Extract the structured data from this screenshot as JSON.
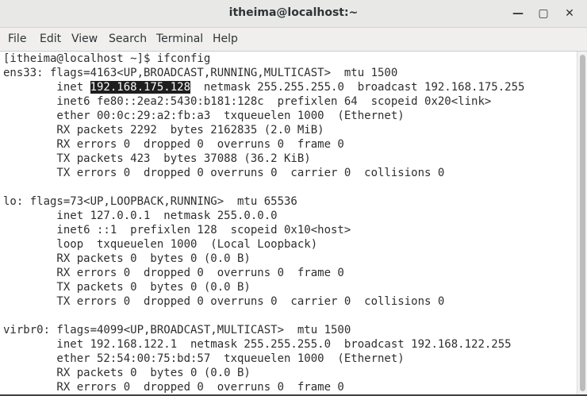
{
  "window": {
    "title": "itheima@localhost:~",
    "controls": {
      "minimize": "—",
      "maximize": "▢",
      "close": "✕"
    }
  },
  "menubar": {
    "items": [
      "File",
      "Edit",
      "View",
      "Search",
      "Terminal",
      "Help"
    ]
  },
  "terminal": {
    "lines": [
      {
        "text": "[itheima@localhost ~]$ ifconfig"
      },
      {
        "text": "ens33: flags=4163<UP,BROADCAST,RUNNING,MULTICAST>  mtu 1500"
      },
      {
        "pre": "        inet ",
        "hl": "192.168.175.128",
        "post": "  netmask 255.255.255.0  broadcast 192.168.175.255"
      },
      {
        "text": "        inet6 fe80::2ea2:5430:b181:128c  prefixlen 64  scopeid 0x20<link>"
      },
      {
        "text": "        ether 00:0c:29:a2:fb:a3  txqueuelen 1000  (Ethernet)"
      },
      {
        "text": "        RX packets 2292  bytes 2162835 (2.0 MiB)"
      },
      {
        "text": "        RX errors 0  dropped 0  overruns 0  frame 0"
      },
      {
        "text": "        TX packets 423  bytes 37088 (36.2 KiB)"
      },
      {
        "text": "        TX errors 0  dropped 0 overruns 0  carrier 0  collisions 0"
      },
      {
        "text": ""
      },
      {
        "text": "lo: flags=73<UP,LOOPBACK,RUNNING>  mtu 65536"
      },
      {
        "text": "        inet 127.0.0.1  netmask 255.0.0.0"
      },
      {
        "text": "        inet6 ::1  prefixlen 128  scopeid 0x10<host>"
      },
      {
        "text": "        loop  txqueuelen 1000  (Local Loopback)"
      },
      {
        "text": "        RX packets 0  bytes 0 (0.0 B)"
      },
      {
        "text": "        RX errors 0  dropped 0  overruns 0  frame 0"
      },
      {
        "text": "        TX packets 0  bytes 0 (0.0 B)"
      },
      {
        "text": "        TX errors 0  dropped 0 overruns 0  carrier 0  collisions 0"
      },
      {
        "text": ""
      },
      {
        "text": "virbr0: flags=4099<UP,BROADCAST,MULTICAST>  mtu 1500"
      },
      {
        "text": "        inet 192.168.122.1  netmask 255.255.255.0  broadcast 192.168.122.255"
      },
      {
        "text": "        ether 52:54:00:75:bd:57  txqueuelen 1000  (Ethernet)"
      },
      {
        "text": "        RX packets 0  bytes 0 (0.0 B)"
      },
      {
        "text": "        RX errors 0  dropped 0  overruns 0  frame 0"
      }
    ]
  },
  "colors": {
    "terminal_bg": "#ffffff",
    "terminal_fg": "#2e2e2e",
    "selection_bg": "#1e1e1e",
    "selection_fg": "#ffffff",
    "titlebar_bg": "#e8e8e7"
  }
}
